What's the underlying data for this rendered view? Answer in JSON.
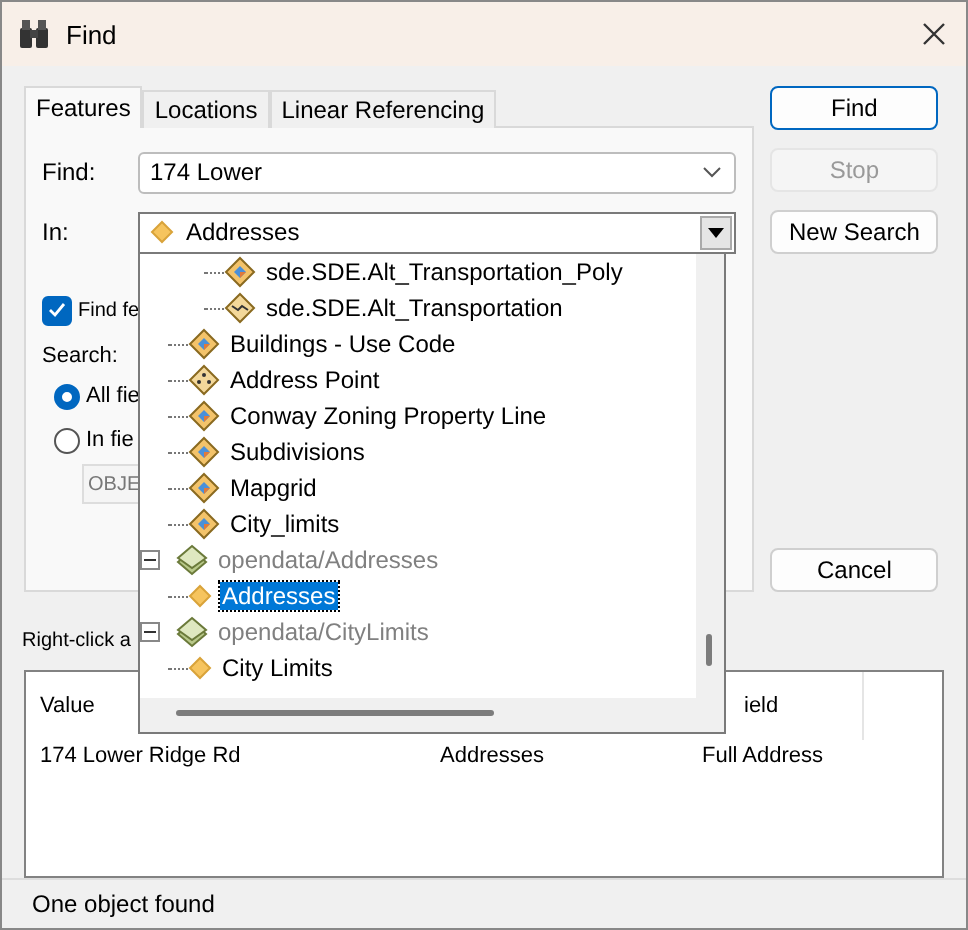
{
  "window": {
    "title": "Find"
  },
  "tabs": [
    {
      "label": "Features",
      "selected": true
    },
    {
      "label": "Locations",
      "selected": false
    },
    {
      "label": "Linear Referencing",
      "selected": false
    }
  ],
  "find": {
    "label": "Find:",
    "value": "174 Lower"
  },
  "in": {
    "label": "In:",
    "value": "Addresses"
  },
  "find_features_checkbox": {
    "label": "Find fe",
    "checked": true
  },
  "search": {
    "label": "Search:",
    "options": [
      {
        "label": "All fie",
        "selected": true
      },
      {
        "label": "In fie",
        "selected": false
      }
    ],
    "field_value": "OBJE"
  },
  "buttons": [
    {
      "label": "Find",
      "kind": "default",
      "disabled": false
    },
    {
      "label": "Stop",
      "kind": "normal",
      "disabled": true
    },
    {
      "label": "New Search",
      "kind": "normal",
      "disabled": false
    }
  ],
  "cancel_button": {
    "label": "Cancel"
  },
  "in_dropdown": {
    "tree": [
      {
        "children": [
          {
            "children": [
              {
                "label": "sde.SDE.Alt_Transportation_Poly",
                "kind": "polygon",
                "selected": false
              },
              {
                "label": "sde.SDE.Alt_Transportation",
                "kind": "line",
                "selected": false
              }
            ]
          },
          {
            "label": "Buildings - Use Code",
            "kind": "polygon",
            "selected": false
          },
          {
            "label": "Address Point",
            "kind": "point",
            "selected": false
          },
          {
            "label": "Conway Zoning Property Line",
            "kind": "polygon",
            "selected": false
          },
          {
            "label": "Subdivisions",
            "kind": "polygon",
            "selected": false
          },
          {
            "label": "Mapgrid",
            "kind": "polygon",
            "selected": false
          },
          {
            "label": "City_limits",
            "kind": "polygon",
            "selected": false
          }
        ]
      },
      {
        "label": "opendata/Addresses",
        "kind": "group",
        "expanded": true,
        "selected": false,
        "children": [
          {
            "label": "Addresses",
            "kind": "feature",
            "selected": true
          }
        ]
      },
      {
        "label": "opendata/CityLimits",
        "kind": "group",
        "expanded": true,
        "selected": false,
        "children": [
          {
            "label": "City Limits",
            "kind": "feature",
            "selected": false
          }
        ]
      }
    ]
  },
  "hint": "Right-click a",
  "results": {
    "column_1_header": "Value",
    "column_3_header": "ield",
    "rows": [
      {
        "cells": [
          "174 Lower Ridge Rd",
          "Addresses",
          "Full Address"
        ]
      }
    ]
  },
  "status_bar": "One object found"
}
